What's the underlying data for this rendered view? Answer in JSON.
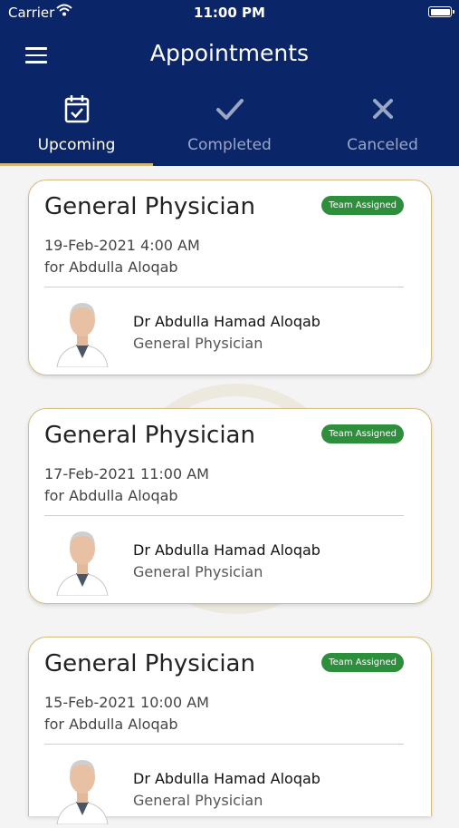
{
  "status_bar": {
    "carrier": "Carrier",
    "time": "11:00 PM"
  },
  "header": {
    "title": "Appointments"
  },
  "tabs": [
    {
      "label": "Upcoming",
      "icon": "calendar-check-icon",
      "active": true
    },
    {
      "label": "Completed",
      "icon": "check-icon",
      "active": false
    },
    {
      "label": "Canceled",
      "icon": "x-icon",
      "active": false
    }
  ],
  "appointments": [
    {
      "specialty": "General Physician",
      "badge": "Team Assigned",
      "datetime": "19-Feb-2021 4:00 AM",
      "patient": "for Abdulla Aloqab",
      "doctor_name": "Dr Abdulla Hamad Aloqab",
      "doctor_specialty": "General Physician"
    },
    {
      "specialty": "General Physician",
      "badge": "Team Assigned",
      "datetime": "17-Feb-2021 11:00 AM",
      "patient": "for Abdulla Aloqab",
      "doctor_name": "Dr Abdulla Hamad Aloqab",
      "doctor_specialty": "General Physician"
    },
    {
      "specialty": "General Physician",
      "badge": "Team Assigned",
      "datetime": "15-Feb-2021 10:00 AM",
      "patient": "for Abdulla Aloqab",
      "doctor_name": "Dr Abdulla Hamad Aloqab",
      "doctor_specialty": "General Physician"
    }
  ],
  "colors": {
    "header": "#0b2569",
    "accent": "#d4b877",
    "badge": "#2d8f3c"
  }
}
